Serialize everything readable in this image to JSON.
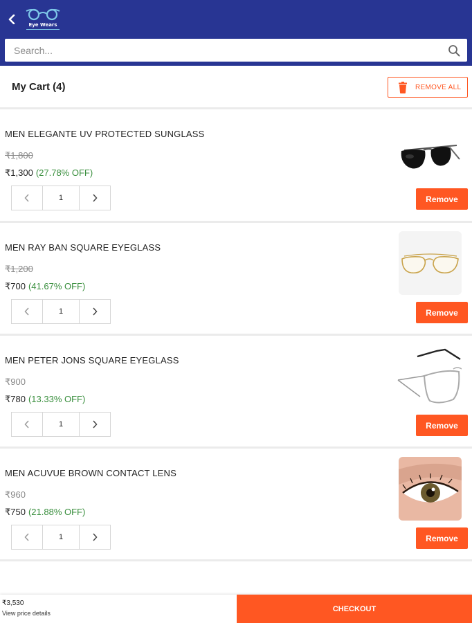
{
  "header": {
    "logo_text": "Eye Wears",
    "search_placeholder": "Search...",
    "brand_color": "#283593"
  },
  "cart": {
    "title": "My Cart (4)",
    "remove_all_label": "REMOVE ALL",
    "accent_color": "#ff5722",
    "discount_color": "#388e3c",
    "items": [
      {
        "name": "MEN ELEGANTE UV PROTECTED SUNGLASS",
        "old_price": "₹1,800",
        "price": "₹1,300",
        "discount": "(27.78% OFF)",
        "quantity": "1",
        "remove_label": "Remove",
        "image": "aviator-sunglass"
      },
      {
        "name": "MEN RAY BAN SQUARE EYEGLASS",
        "old_price": "₹1,200",
        "price": "₹700",
        "discount": "(41.67% OFF)",
        "quantity": "1",
        "remove_label": "Remove",
        "image": "gold-aviator-eyeglass"
      },
      {
        "name": "MEN PETER JONS SQUARE EYEGLASS",
        "old_price": "₹900",
        "price": "₹780",
        "discount": "(13.33% OFF)",
        "quantity": "1",
        "remove_label": "Remove",
        "image": "silver-square-eyeglass"
      },
      {
        "name": "MEN ACUVUE BROWN CONTACT LENS",
        "old_price": "₹960",
        "price": "₹750",
        "discount": "(21.88% OFF)",
        "quantity": "1",
        "remove_label": "Remove",
        "image": "brown-eye-contact-lens"
      }
    ]
  },
  "footer": {
    "total": "₹3,530",
    "view_details": "View price details",
    "checkout_label": "CHECKOUT"
  }
}
